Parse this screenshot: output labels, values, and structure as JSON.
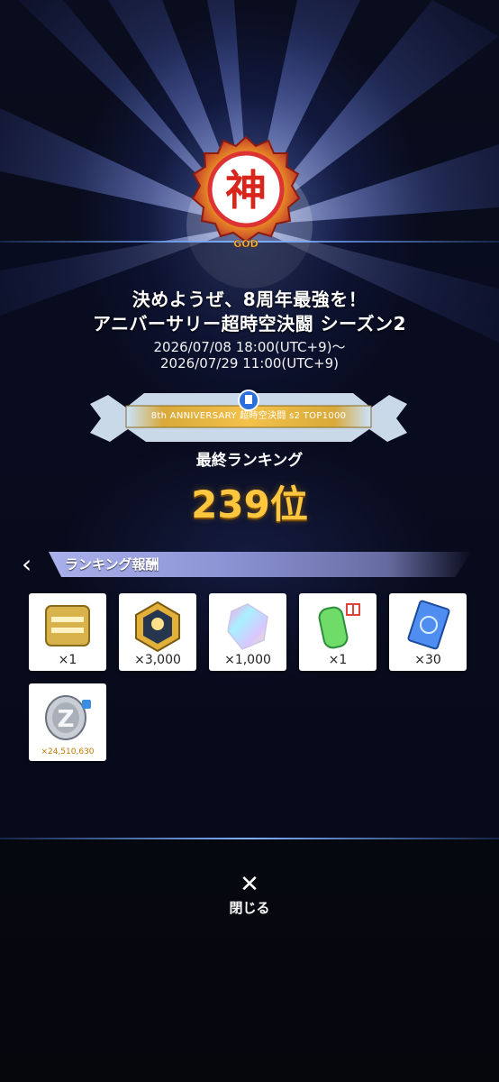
{
  "event": {
    "title_line1": "決めようぜ、8周年最強を！",
    "title_line2": "アニバーサリー超時空決闘 シーズン2",
    "start": "2026/07/08 18:00(UTC+9)〜",
    "end": "2026/07/29 11:00(UTC+9)",
    "emblem_text": "神",
    "emblem_sub": "GOD"
  },
  "banner": {
    "text": "8th ANNIVERSARY 超時空決闘 s2 TOP1000"
  },
  "ranking": {
    "label": "最終ランキング",
    "value": "239位"
  },
  "rewards": {
    "section_title": "ランキング報酬",
    "items": [
      {
        "icon": "gold-plate-icon",
        "qty": "×1"
      },
      {
        "icon": "character-medal-icon",
        "qty": "×3,000"
      },
      {
        "icon": "rainbow-crystal-icon",
        "qty": "×1,000"
      },
      {
        "icon": "green-capsule-gift-icon",
        "qty": "×1"
      },
      {
        "icon": "blue-ticket-icon",
        "qty": "×30"
      },
      {
        "icon": "zeni-coin-icon",
        "qty": "×24,510,630"
      }
    ]
  },
  "close": {
    "label": "閉じる",
    "glyph": "✕"
  },
  "colors": {
    "rank": "#ffc640",
    "accent_line": "#7fb0ff",
    "section_bar": "#a9b0ea"
  }
}
